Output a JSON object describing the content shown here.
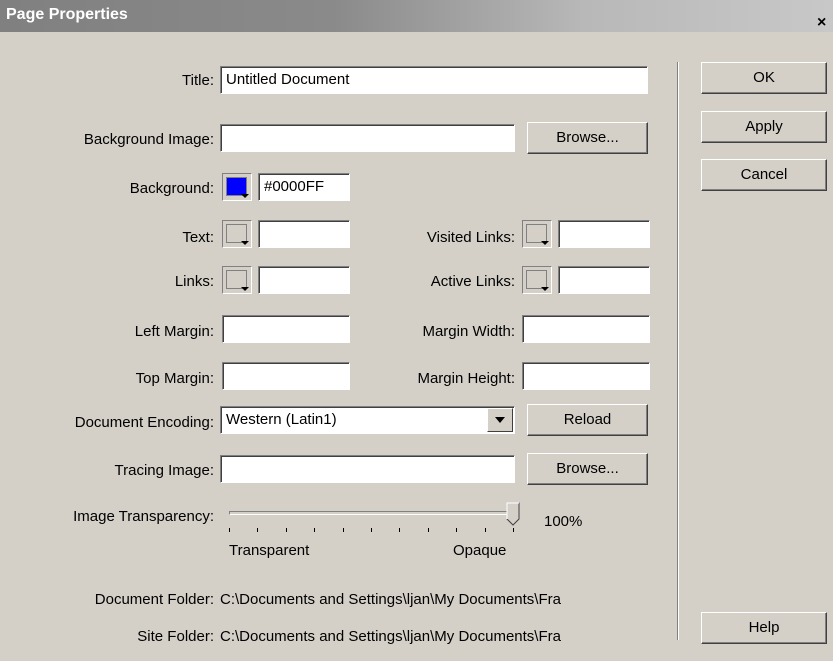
{
  "window": {
    "title": "Page Properties",
    "close": "×"
  },
  "buttons": {
    "ok": "OK",
    "apply": "Apply",
    "cancel": "Cancel",
    "help": "Help"
  },
  "title_field": {
    "label": "Title:",
    "value": "Untitled Document"
  },
  "background_image": {
    "label": "Background Image:",
    "value": "",
    "browse": "Browse..."
  },
  "background": {
    "label": "Background:",
    "color": "#0000FF",
    "value": "#0000FF"
  },
  "text": {
    "label": "Text:",
    "value": ""
  },
  "visited_links": {
    "label": "Visited Links:",
    "value": ""
  },
  "links": {
    "label": "Links:",
    "value": ""
  },
  "active_links": {
    "label": "Active Links:",
    "value": ""
  },
  "left_margin": {
    "label": "Left Margin:",
    "value": ""
  },
  "margin_width": {
    "label": "Margin Width:",
    "value": ""
  },
  "top_margin": {
    "label": "Top Margin:",
    "value": ""
  },
  "margin_height": {
    "label": "Margin Height:",
    "value": ""
  },
  "document_encoding": {
    "label": "Document Encoding:",
    "value": "Western (Latin1)",
    "reload": "Reload"
  },
  "tracing_image": {
    "label": "Tracing Image:",
    "value": "",
    "browse": "Browse..."
  },
  "image_transparency": {
    "label": "Image Transparency:",
    "percent_label": "100%",
    "value": 1.0,
    "min_label": "Transparent",
    "max_label": "Opaque"
  },
  "document_folder": {
    "label": "Document Folder:",
    "value": "C:\\Documents and Settings\\ljan\\My Documents\\Fra"
  },
  "site_folder": {
    "label": "Site Folder:",
    "value": "C:\\Documents and Settings\\ljan\\My Documents\\Fra"
  }
}
